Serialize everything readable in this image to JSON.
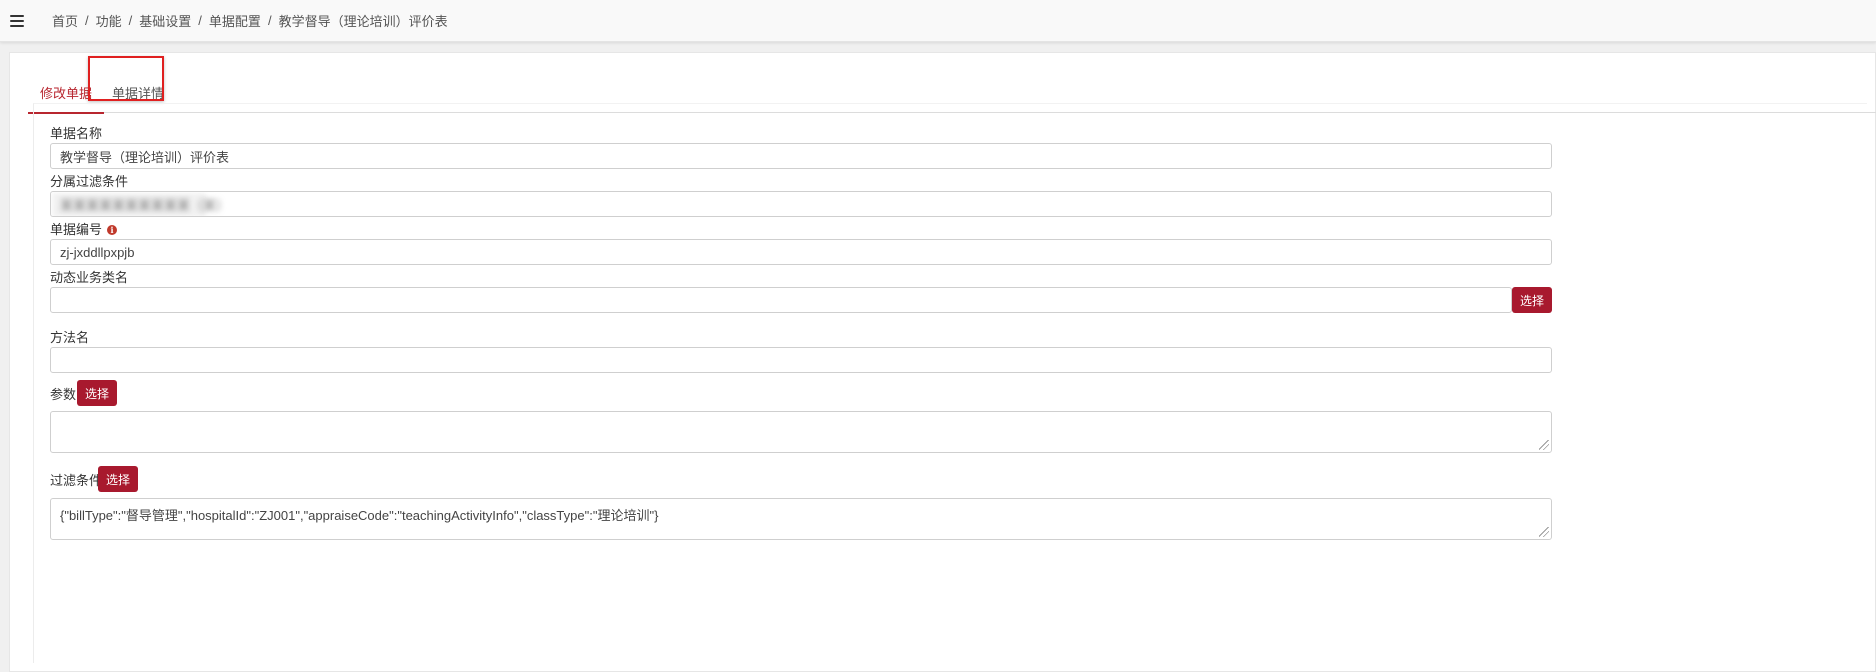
{
  "breadcrumb": {
    "items": [
      "首页",
      "功能",
      "基础设置",
      "单据配置",
      "教学督导（理论培训）评价表"
    ],
    "separator": "/"
  },
  "tabs": [
    {
      "label": "修改单据",
      "active": true
    },
    {
      "label": "单据详情",
      "active": false
    }
  ],
  "form": {
    "bill_name": {
      "label": "单据名称",
      "value": "教学督导（理论培训）评价表"
    },
    "sub_filter": {
      "label": "分属过滤条件",
      "value": "某某某某某某某某某某（某）"
    },
    "bill_code": {
      "label": "单据编号",
      "value": "zj-jxddllpxpjb",
      "info_icon": "info-icon"
    },
    "dynamic_class": {
      "label": "动态业务类名",
      "value": "",
      "button": "选择"
    },
    "method_name": {
      "label": "方法名",
      "value": ""
    },
    "params": {
      "label": "参数",
      "value": "",
      "button": "选择"
    },
    "filter": {
      "label": "过滤条件",
      "value": "{\"billType\":\"督导管理\",\"hospitalId\":\"ZJ001\",\"appraiseCode\":\"teachingActivityInfo\",\"classType\":\"理论培训\"}",
      "button": "选择"
    }
  },
  "colors": {
    "accent": "#b8262f",
    "button_bg": "#a8192e",
    "highlight": "#e02020"
  }
}
